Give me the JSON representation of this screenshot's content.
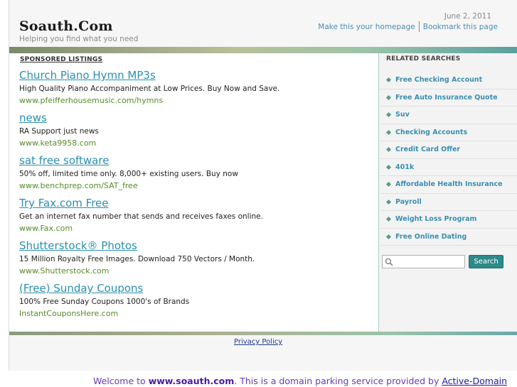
{
  "header": {
    "site_title": "Soauth.Com",
    "tagline": "Helping you find what you need",
    "date": "June 2, 2011",
    "link_homepage": "Make this your homepage",
    "link_bookmark": "Bookmark this page"
  },
  "main": {
    "sponsored_label": "SPONSORED LISTINGS",
    "listings": [
      {
        "title": "Church Piano Hymn MP3s",
        "desc": "High Quality Piano Accompaniment at Low Prices. Buy Now and Save.",
        "url": "www.pfeifferhousemusic.com/hymns"
      },
      {
        "title": "news",
        "desc": "RA Support just news",
        "url": "www.keta9958.com"
      },
      {
        "title": "sat free software",
        "desc": "50% off, limited time only. 8,000+ existing users. Buy now",
        "url": "www.benchprep.com/SAT_free"
      },
      {
        "title": "Try Fax.com Free",
        "desc": "Get an internet fax number that sends and receives faxes online.",
        "url": "www.Fax.com"
      },
      {
        "title": "Shutterstock® Photos",
        "desc": "15 Million Royalty Free Images. Download 750 Vectors / Month.",
        "url": "www.Shutterstock.com"
      },
      {
        "title": "(Free) Sunday Coupons",
        "desc": "100% Free Sunday Coupons 1000's of Brands",
        "url": "InstantCouponsHere.com"
      }
    ]
  },
  "sidebar": {
    "heading": "RELATED SEARCHES",
    "items": [
      "Free Checking Account",
      "Free Auto Insurance Quote",
      "Suv",
      "Checking Accounts",
      "Credit Card Offer",
      "401k",
      "Affordable Health Insurance",
      "Payroll",
      "Weight Loss Program",
      "Free Online Dating"
    ],
    "search_value": "",
    "search_button": "Search"
  },
  "footer": {
    "privacy": "Privacy Policy",
    "welcome_prefix": "Welcome to ",
    "welcome_domain": "www.soauth.com",
    "welcome_middle": ". This is a domain parking service provided by ",
    "welcome_provider": "Active-Domain"
  },
  "colors": {
    "link": "#2a8fb0",
    "url_green": "#5a8a2a",
    "search_button": "#2d8a8a",
    "welcome_text": "#6a3ab0"
  },
  "icons": {
    "search": "magnifier-icon",
    "bullet": "diamond-bullet-icon"
  }
}
